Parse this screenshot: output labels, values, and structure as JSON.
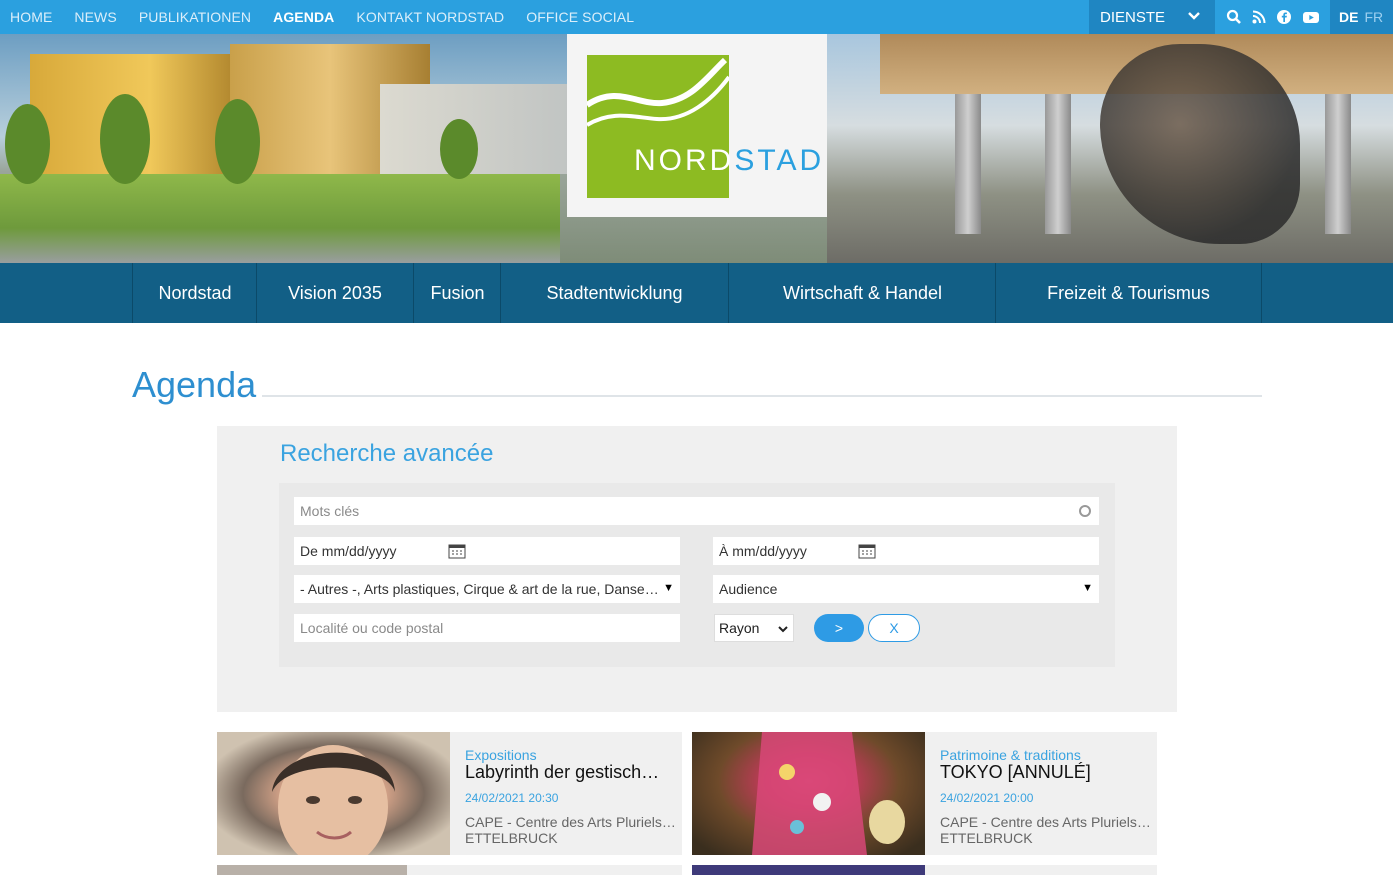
{
  "topnav": {
    "items": [
      {
        "label": "HOME",
        "active": false
      },
      {
        "label": "NEWS",
        "active": false
      },
      {
        "label": "PUBLIKATIONEN",
        "active": false
      },
      {
        "label": "AGENDA",
        "active": true
      },
      {
        "label": "KONTAKT NORDSTAD",
        "active": false
      },
      {
        "label": "OFFICE SOCIAL",
        "active": false
      }
    ],
    "dienste_label": "DIENSTE",
    "icons": [
      "search-icon",
      "rss-icon",
      "facebook-icon",
      "youtube-icon"
    ],
    "lang": {
      "de": "DE",
      "fr": "FR"
    }
  },
  "logo": {
    "text_nord": "NORD",
    "text_stad": "STAD"
  },
  "mainnav": {
    "items": [
      {
        "label": "Nordstad"
      },
      {
        "label": "Vision 2035"
      },
      {
        "label": "Fusion"
      },
      {
        "label": "Stadtentwicklung"
      },
      {
        "label": "Wirtschaft & Handel"
      },
      {
        "label": "Freizeit & Tourismus"
      }
    ]
  },
  "page": {
    "title": "Agenda"
  },
  "search": {
    "title": "Recherche avancée",
    "keywords_placeholder": "Mots clés",
    "date_from_placeholder": "De mm/dd/yyyy",
    "date_to_placeholder": "À mm/dd/yyyy",
    "category_value": "- Autres -, Arts plastiques, Cirque & art de la rue, Danse, ...",
    "audience_value": "Audience",
    "location_placeholder": "Localité ou code postal",
    "rayon_value": "Rayon",
    "submit_label": ">",
    "reset_label": "X"
  },
  "events": [
    {
      "category": "Expositions",
      "title": "Labyrinth der gestisch…",
      "date": "24/02/2021 20:30",
      "place": "CAPE - Centre des Arts Pluriels …",
      "city": "ETTELBRUCK"
    },
    {
      "category": "Patrimoine & traditions",
      "title": "TOKYO [ANNULÉ]",
      "date": "24/02/2021 20:00",
      "place": "CAPE - Centre des Arts Pluriels …",
      "city": "ETTELBRUCK"
    }
  ],
  "colors": {
    "brand_blue": "#2ba0df",
    "nav_dark": "#125f86",
    "logo_green": "#8dbb22"
  }
}
